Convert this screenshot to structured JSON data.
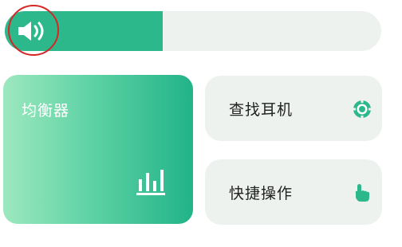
{
  "volume": {
    "level": 0.42,
    "icon": "speaker-volume-icon",
    "fill_color": "#2db88c",
    "track_color": "#eef2ef"
  },
  "equalizer": {
    "label": "均衡器",
    "icon": "equalizer-bars-icon"
  },
  "find_earphones": {
    "label": "查找耳机",
    "icon": "locate-target-icon"
  },
  "quick_actions": {
    "label": "快捷操作",
    "icon": "tap-hand-icon"
  },
  "colors": {
    "accent": "#2db88c",
    "card_bg": "#eef2ef",
    "highlight_ring": "#d52626"
  }
}
